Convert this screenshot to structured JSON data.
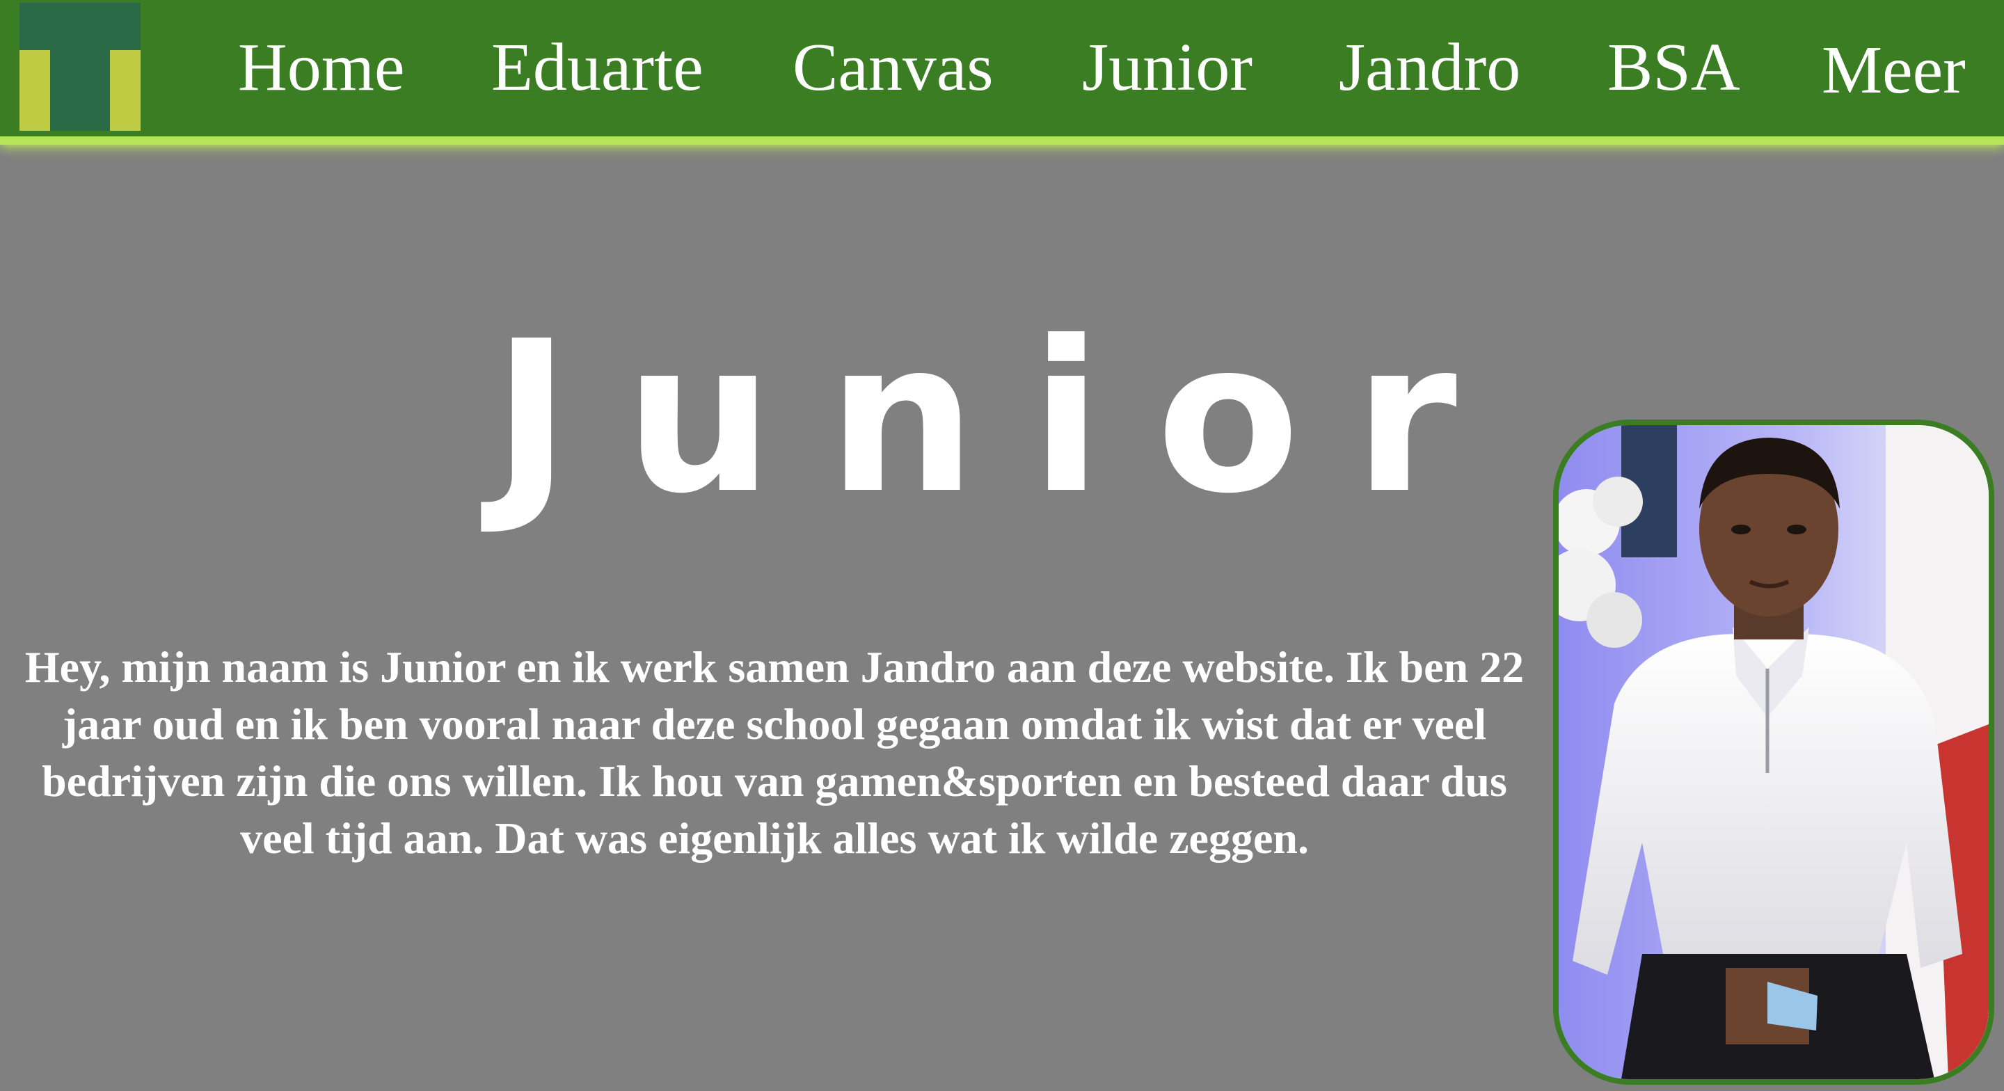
{
  "header": {
    "logo_name": "T-logo",
    "nav": [
      {
        "label": "Home"
      },
      {
        "label": "Eduarte"
      },
      {
        "label": "Canvas"
      },
      {
        "label": "Junior"
      },
      {
        "label": "Jandro"
      },
      {
        "label": "BSA"
      },
      {
        "label": "Meer"
      }
    ]
  },
  "main": {
    "title": "Junior",
    "bio": "Hey, mijn naam is Junior en ik werk samen Jandro aan deze website. Ik ben 22 jaar oud en ik ben vooral naar deze school gegaan omdat ik wist dat er veel bedrijven zijn die ons willen. Ik hou van gamen&sporten en besteed daar dus veel tijd aan. Dat was eigenlijk alles wat ik wilde zeggen."
  },
  "colors": {
    "header_bg": "#3a7d22",
    "header_glow": "#b5e35a",
    "page_bg": "#808080",
    "logo_dark": "#2a6a46",
    "logo_yellow": "#bfcc43",
    "photo_border": "#3a7d22"
  }
}
